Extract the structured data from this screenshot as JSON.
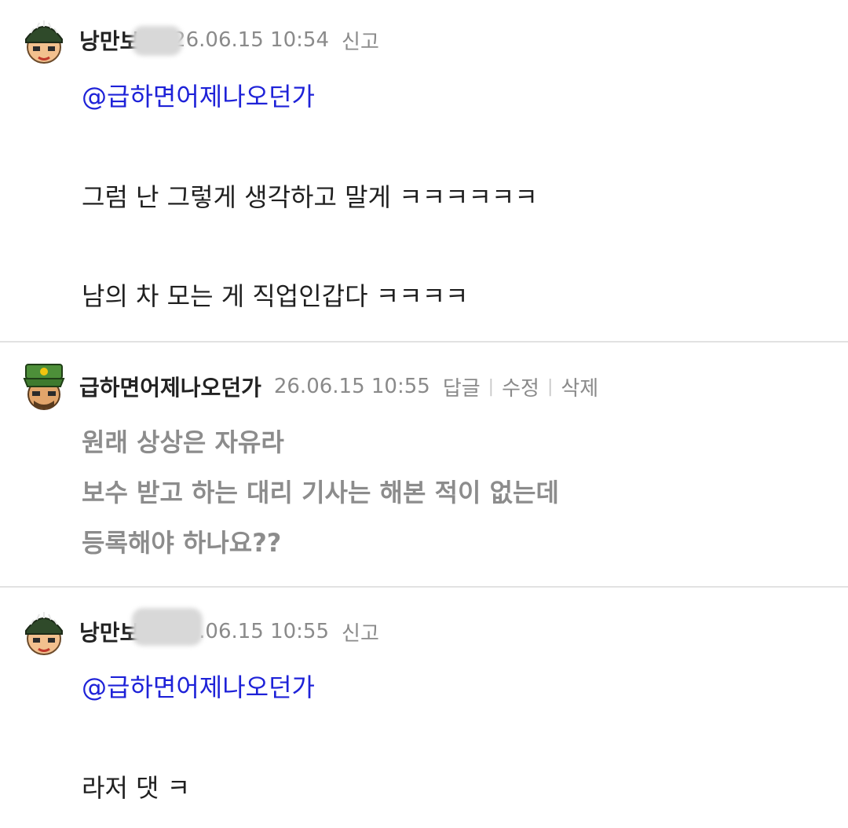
{
  "comments": [
    {
      "nickname": "낭만보드",
      "date": "26.06.15 10:54",
      "actions": [
        "신고"
      ],
      "mention": "@급하면어제나오던가",
      "lines": [
        "그럼 난 그렇게 생각하고 말게 ㅋㅋㅋㅋㅋㅋ",
        "남의 차 모는 게 직업인갑다 ㅋㅋㅋㅋ"
      ]
    },
    {
      "nickname": "급하면어제나오던가",
      "date": "26.06.15 10:55",
      "actions": [
        "답글",
        "수정",
        "삭제"
      ],
      "lines": [
        "원래 상상은 자유라",
        "보수 받고 하는 대리 기사는 해본 적이 없는데",
        "등록해야 하나요??"
      ]
    },
    {
      "nickname": "낭만보드",
      "date": "26.06.15 10:55",
      "actions": [
        "신고"
      ],
      "mention": "@급하면어제나오던가",
      "lines": [
        "라저 댓 ㅋ"
      ]
    }
  ],
  "colors": {
    "mention": "#1e22d8",
    "meta": "#8a8a8a",
    "divider": "#e2e2e2"
  }
}
